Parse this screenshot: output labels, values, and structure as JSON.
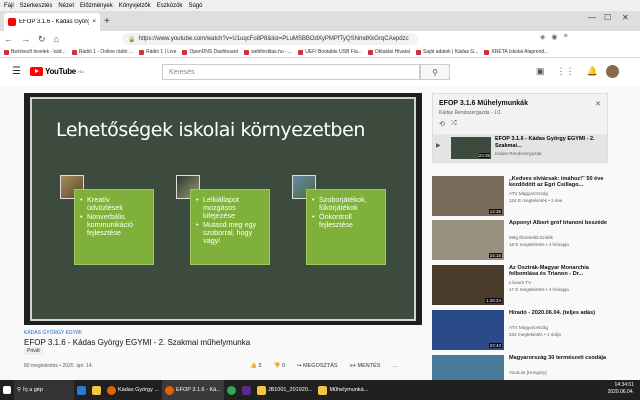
{
  "menubar": [
    "Fájl",
    "Szerkesztés",
    "Nézet",
    "Előzmények",
    "Könyvjelzők",
    "Eszközök",
    "Súgó"
  ],
  "tab": {
    "label": "EFOP 3.1.6 - Kádas György EGY..."
  },
  "navbar": {
    "url": "https://www.youtube.com/watch?v=U1uqcFo8P8&list=PLuMSBBOdXyPMPfTyQSNmdKkGrqCAepdzc"
  },
  "bookmarks": [
    "Beérkező levelek - kád...",
    "Rádió 1 - Online rádió ...",
    "Rádió 1 | Live",
    "OpenDNS Dashboard",
    "webforditas.hu - ...",
    "UEFI Bootable USB Fla...",
    "Oktatási Hivatal",
    "Saját adatok | Kádas G...",
    "KRÉTA Iskolai Alaprend..."
  ],
  "youtube": {
    "logo": "YouTube",
    "logo_sup": "HU",
    "search_placeholder": "Keresés"
  },
  "slide": {
    "title": "Lehetőségek iskolai környezetben",
    "boxes": [
      [
        "Kreatív üdvözlések",
        "Nonverbális kommunikáció fejlesztése"
      ],
      [
        "Lelkiállapot mozgásos kifejezése",
        "Mutasd meg egy szoborral, hogy vagy!"
      ],
      [
        "Szoborjátékok, fűkörjátékok",
        "Önkontroll fejlesztése"
      ]
    ]
  },
  "video": {
    "channel_tag": "KÁDAS GYÖRGY EGYMI",
    "title": "EFOP 3.1.6 - Kádas György EGYMI - 2. Szakmai műhelymunka",
    "privacy": "Privát",
    "views": "80 megtekintés • 2020. ápr. 14.",
    "likes": "3",
    "dislikes": "0",
    "share": "MEGOSZTÁS",
    "save": "MENTÉS"
  },
  "playlist": {
    "title": "EFOP 3.1.6 Műhelymunkák",
    "subtitle": "Kádas Rendszergazda - 1/1",
    "item_title": "EFOP 3.1.6 - Kádas György EGYMI - 2. Szakmai...",
    "item_channel": "Kádas Rendszergazda",
    "item_duration": "23:35"
  },
  "sidebar_videos": [
    {
      "title": "„Kedves elvtársak: imához!” 50 éve kezdődött az Egri Csillago...",
      "channel": "ATV Magyarország",
      "meta": "124 E megtekintés • 2 éve",
      "duration": "14:26",
      "color": "#7a6a5a"
    },
    {
      "title": "Apponyi Albert gróf trianoni beszéde",
      "channel": "Még Ébresebb Emlék",
      "meta": "18 E megtekintés • 4 hónapja",
      "duration": "24:15",
      "color": "#9a9080"
    },
    {
      "title": "Az Osztrák-Magyar Monarchia felbomlása és Trianon - Dr...",
      "channel": "Líceum TV",
      "meta": "17 E megtekintés • 4 hónapja",
      "duration": "1:26:24",
      "color": "#4a3a2a"
    },
    {
      "title": "Híradó - 2020.06.04. (teljes adás)",
      "channel": "ATV Magyarország",
      "meta": "234 megtekintés • 1 órája",
      "duration": "23:42",
      "color": "#2a4a8a"
    },
    {
      "title": "Magyarország 30 természeti csodája",
      "channel": "YourList [Hungary]",
      "meta": "",
      "duration": "",
      "color": "#4a7a9a"
    }
  ],
  "taskbar": [
    "Írj a gép",
    "Kádas György ...",
    "EFOP 3.1.6 - Ká...",
    "JB1001_201920...",
    "Műhelymunká..."
  ],
  "clock": {
    "time": "14:34:01",
    "date": "2020.06.04."
  }
}
